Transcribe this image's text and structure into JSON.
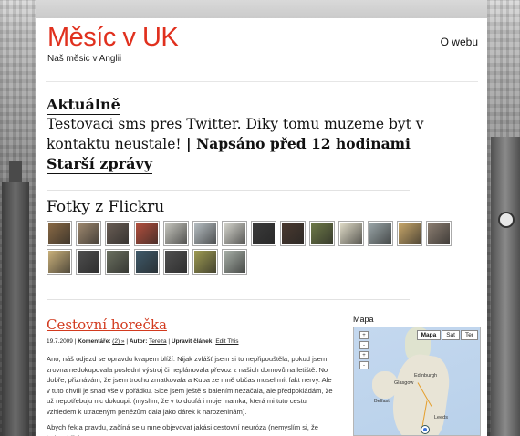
{
  "site": {
    "title": "Měsíc v UK",
    "tagline": "Naš měsic v Anglii",
    "nav_about": "O webu"
  },
  "aktualne": {
    "heading": "Aktuálně",
    "tweet": "Testovaci sms pres Twitter. Diky tomu muzeme byt v kontaktu neustale!",
    "separator": " | ",
    "posted": "Napsáno před 12 hodinami",
    "older": "Starší zprávy"
  },
  "flickr": {
    "title": "Fotky z Flickru",
    "thumb_colors": [
      "#8a6a45",
      "#a08a70",
      "#6a5e55",
      "#b4503e",
      "#c8c8c0",
      "#b8c0c4",
      "#d8d8d0",
      "#3a3a3a",
      "#4a3a30",
      "#6e7a48",
      "#e0dcc8",
      "#9aa6a8",
      "#c9a86a",
      "#8d7f72",
      "#c9b07a",
      "#4e4e4e",
      "#6b7060",
      "#3f5a6a",
      "#505050",
      "#9d9a52",
      "#a8b0a8"
    ]
  },
  "post": {
    "title": "Cestovní horečka",
    "date": "19.7.2009",
    "comments_label": "Komentáře:",
    "comments_value": "(2) »",
    "author_label": "Autor:",
    "author_value": "Tereza",
    "edit_label": "Upravit článek:",
    "edit_value": "Edit This",
    "paragraphs": [
      "Ano, náš odjezd se opravdu kvapem blíží. Nijak zvlášť jsem si to nepřipouštěla, pokud jsem zrovna nedokupovala poslední výstroj či neplánovala převoz z našich domovů na letiště. No dobře, přiznávám, že jsem trochu zmatkovala a Kuba ze mně občas musel mít fakt nervy. Ale v tuto chvíli je snad vše v pořádku. Sice jsem ještě s balením nezačala, ale předpokládám, že už nepotřebuju nic dokoupit (myslím, že v to doufá i moje mamka, která mi tuto cestu vzhledem k utraceným penězům dala jako dárek k narozeninám).",
      "Abych řekla pravdu, začíná se u mne objevovat jakási cestovní neuróza (nemyslím si, že bolest břicha"
    ]
  },
  "sidebar": {
    "map_title": "Mapa",
    "map_types": [
      "Mapa",
      "Sat",
      "Ter"
    ],
    "map_controls": [
      "+",
      "-",
      "+",
      "-"
    ],
    "cities": [
      "Edinburgh",
      "Glasgow",
      "Belfast",
      "Leeds"
    ]
  }
}
